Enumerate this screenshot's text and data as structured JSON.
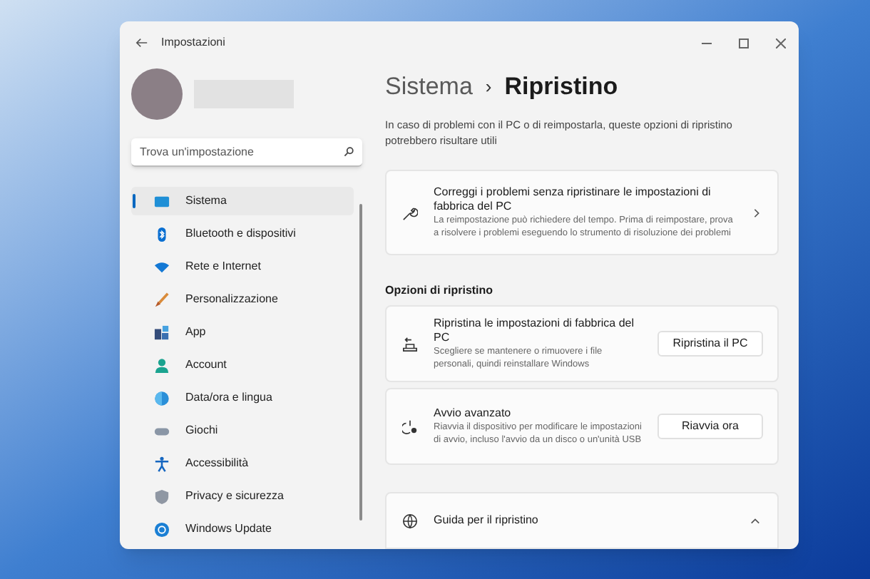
{
  "window": {
    "title": "Impostazioni"
  },
  "search": {
    "placeholder": "Trova un'impostazione"
  },
  "sidebar": {
    "items": [
      {
        "label": "Sistema",
        "selected": true
      },
      {
        "label": "Bluetooth e dispositivi",
        "selected": false
      },
      {
        "label": "Rete e Internet",
        "selected": false
      },
      {
        "label": "Personalizzazione",
        "selected": false
      },
      {
        "label": "App",
        "selected": false
      },
      {
        "label": "Account",
        "selected": false
      },
      {
        "label": "Data/ora e lingua",
        "selected": false
      },
      {
        "label": "Giochi",
        "selected": false
      },
      {
        "label": "Accessibilità",
        "selected": false
      },
      {
        "label": "Privacy e sicurezza",
        "selected": false
      },
      {
        "label": "Windows Update",
        "selected": false
      }
    ]
  },
  "breadcrumb": {
    "parent": "Sistema",
    "separator": "›",
    "current": "Ripristino"
  },
  "description": "In caso di problemi con il PC o di reimpostarla, queste opzioni di ripristino potrebbero risultare utili",
  "fix_card": {
    "title": "Correggi i problemi senza ripristinare le impostazioni di fabbrica del PC",
    "subtitle": "La reimpostazione può richiedere del tempo. Prima di reimpostare, prova a risolvere i problemi eseguendo lo strumento di risoluzione dei problemi"
  },
  "section_title": "Opzioni di ripristino",
  "options": [
    {
      "title": "Ripristina le impostazioni di fabbrica del PC",
      "subtitle": "Scegliere se mantenere o rimuovere i file personali, quindi reinstallare Windows",
      "button": "Ripristina il PC"
    },
    {
      "title": "Avvio avanzato",
      "subtitle": "Riavvia il dispositivo per modificare le impostazioni di avvio, incluso l'avvio da un disco o un'unità USB",
      "button": "Riavvia ora"
    }
  ],
  "help_card": {
    "title": "Guida per il ripristino",
    "expanded": true
  }
}
